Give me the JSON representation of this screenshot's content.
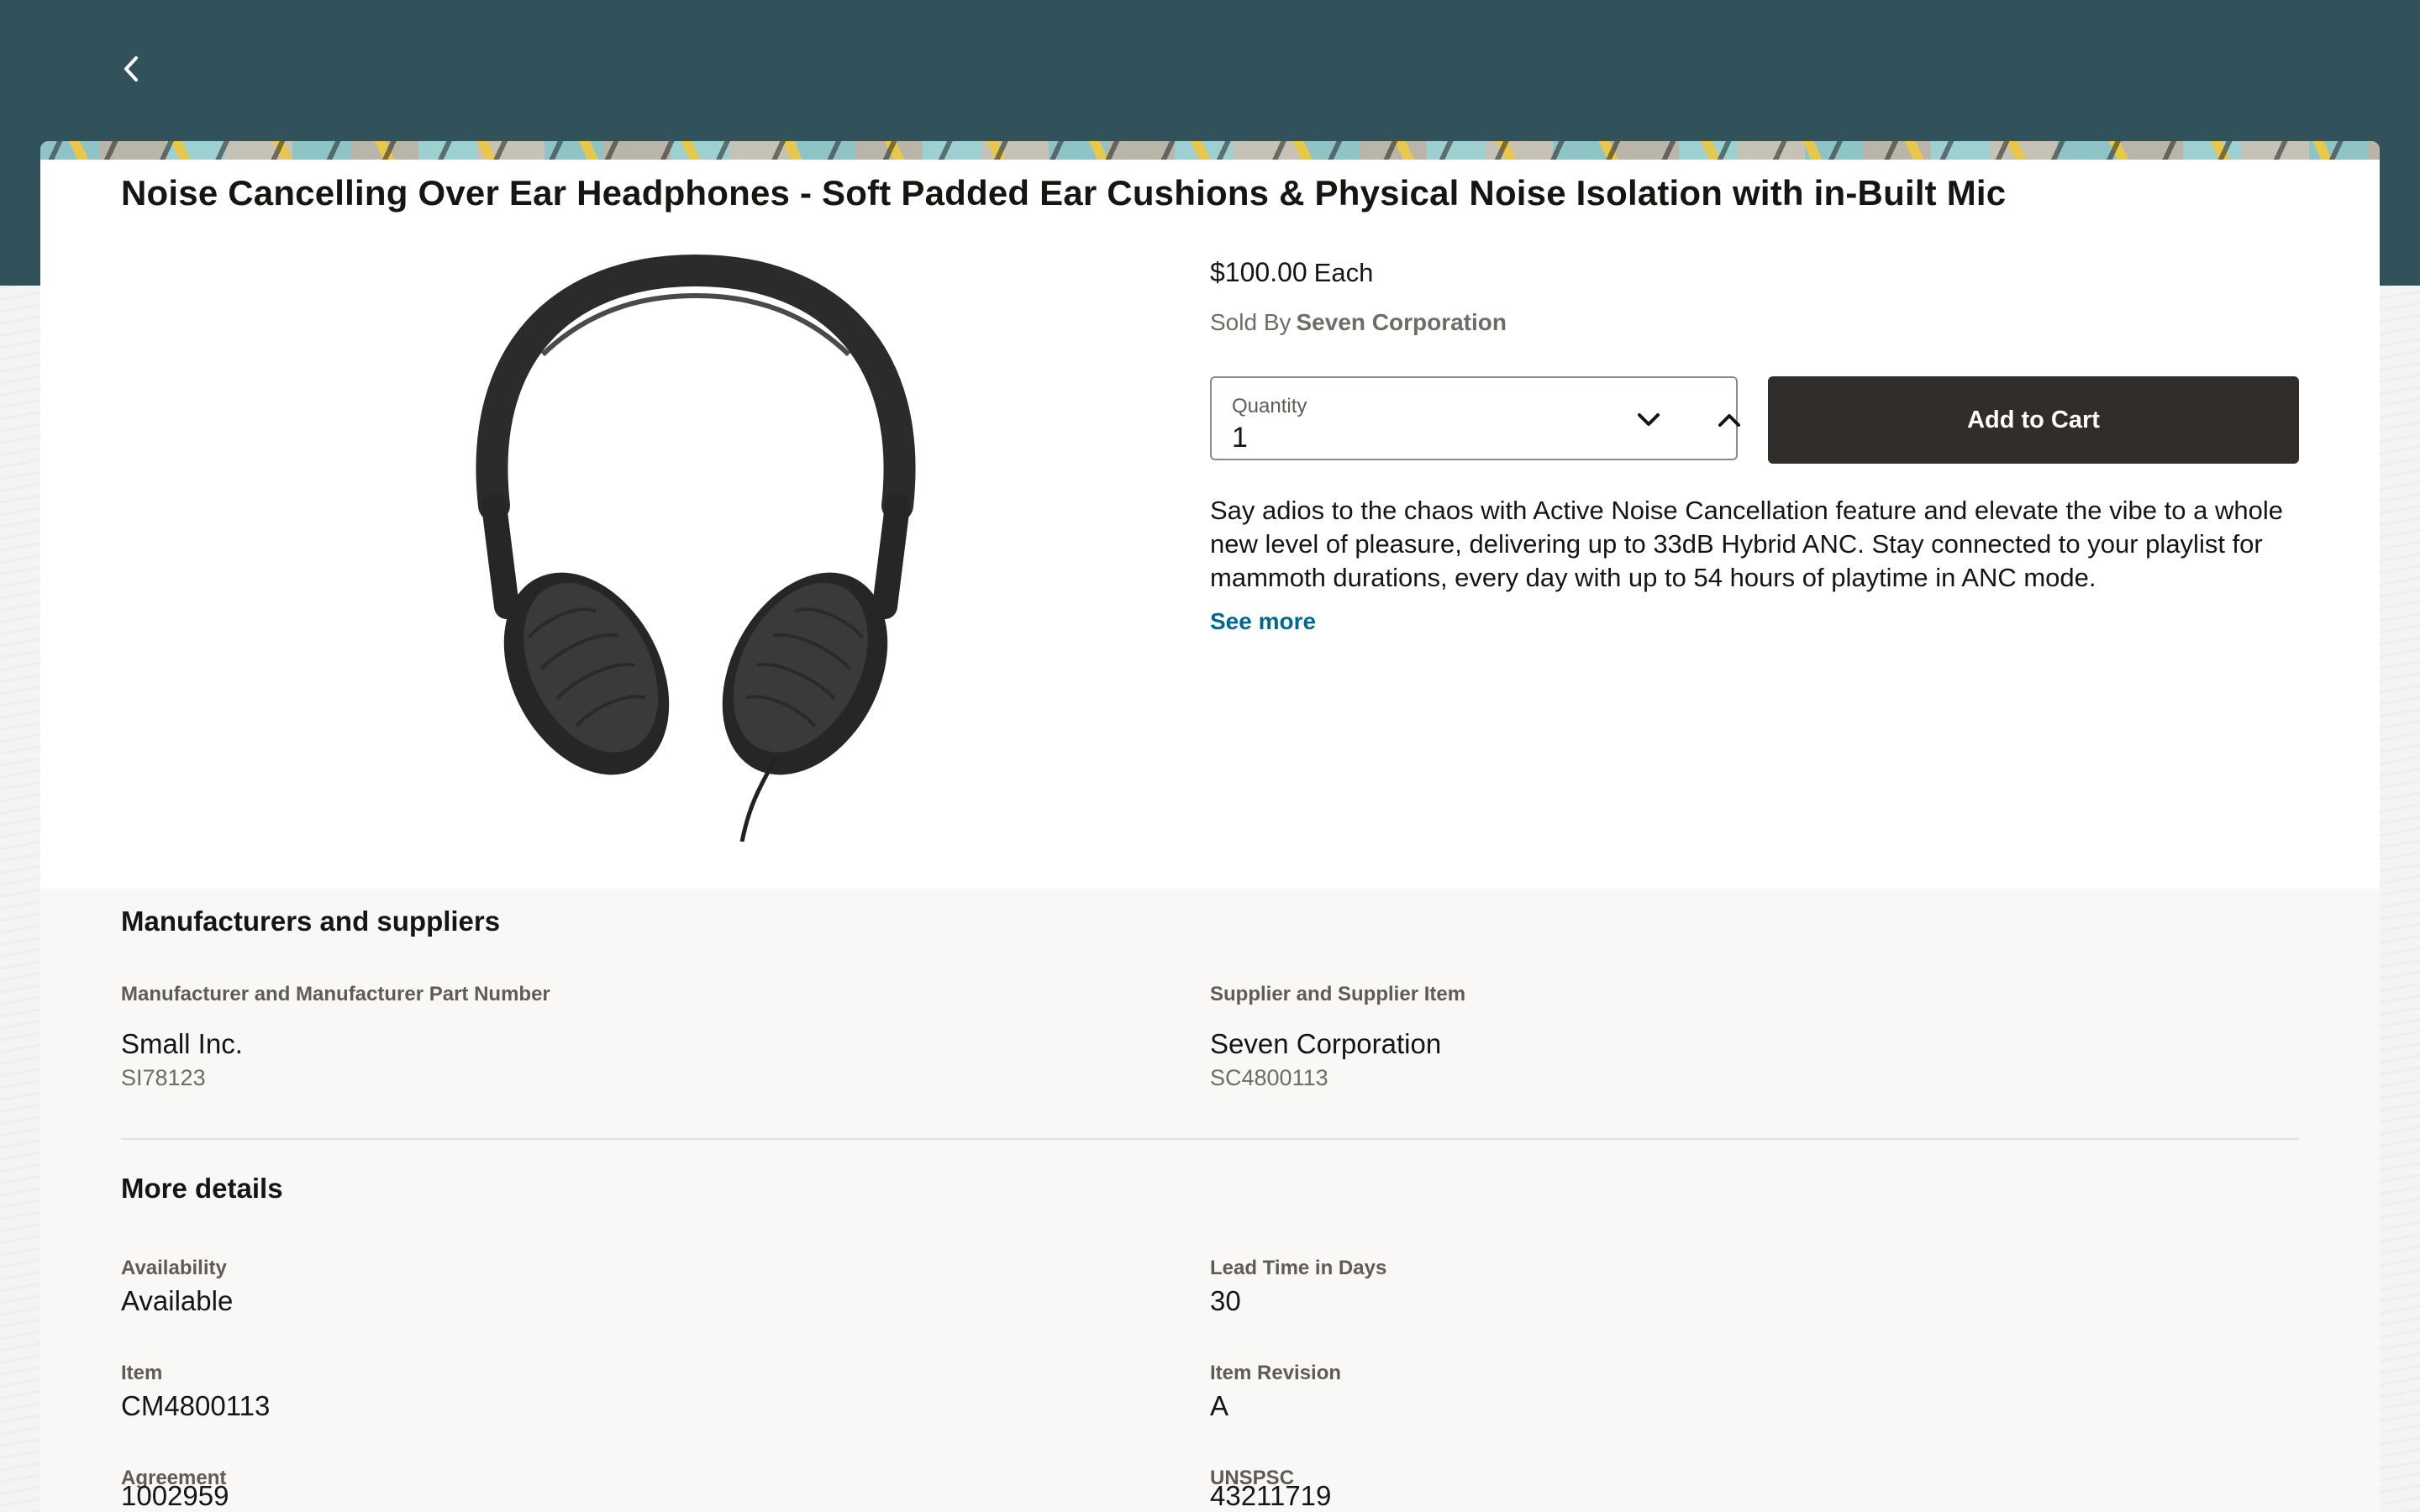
{
  "header": {
    "back_icon": "chevron-left-icon",
    "brand_color": "#31525a"
  },
  "product": {
    "title": "Noise Cancelling Over Ear Headphones - Soft Padded Ear Cushions & Physical Noise Isolation with in-Built Mic",
    "price": "$100.00",
    "unit": "Each",
    "sold_by_label": "Sold By",
    "seller": "Seven Corporation",
    "quantity_label": "Quantity",
    "quantity_value": "1",
    "add_to_cart_label": "Add to Cart",
    "description": "Say adios to the chaos with Active Noise Cancellation feature and elevate the vibe to a whole new level of pleasure, delivering up to 33dB Hybrid ANC. Stay connected to your playlist for mammoth durations, every day with up to 54 hours of playtime in ANC mode.",
    "see_more_label": "See more",
    "image_icon": "headphones-image"
  },
  "manufacturers": {
    "heading": "Manufacturers and suppliers",
    "manufacturer_label": "Manufacturer and Manufacturer Part Number",
    "manufacturer_name": "Small Inc.",
    "manufacturer_part": "SI78123",
    "supplier_label": "Supplier and Supplier Item",
    "supplier_name": "Seven Corporation",
    "supplier_item": "SC4800113"
  },
  "more_details": {
    "heading": "More details",
    "availability_label": "Availability",
    "availability_value": "Available",
    "lead_time_label": "Lead Time in Days",
    "lead_time_value": "30",
    "item_label": "Item",
    "item_value": "CM4800113",
    "item_revision_label": "Item Revision",
    "item_revision_value": "A",
    "agreement_label": "Agreement",
    "agreement_value": "1002959",
    "unspsc_label": "UNSPSC",
    "unspsc_value": "43211719"
  }
}
